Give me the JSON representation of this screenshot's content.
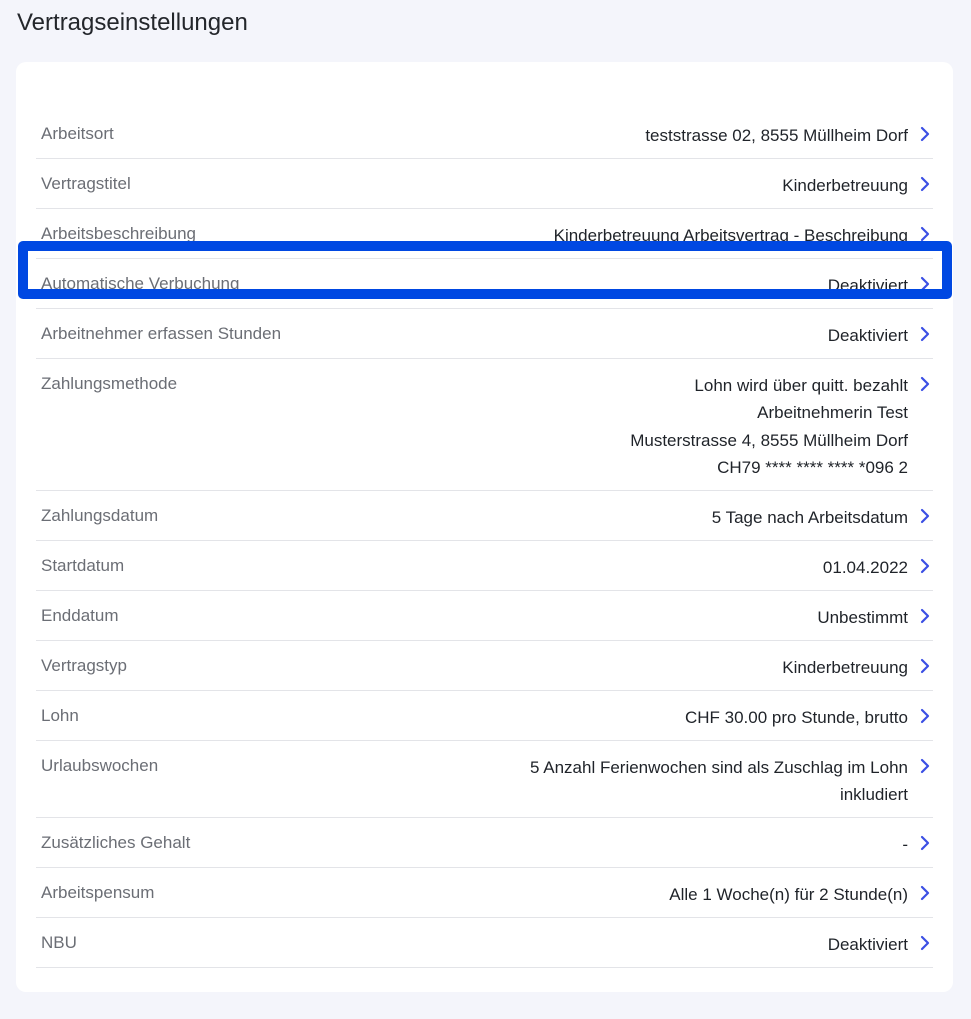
{
  "page": {
    "title": "Vertragseinstellungen"
  },
  "colors": {
    "accent": "#3b4fe4",
    "highlight": "#0048e2",
    "label": "#6b6e75",
    "value": "#1f2329"
  },
  "rows": [
    {
      "key": "arbeitsort",
      "label": "Arbeitsort",
      "values": [
        "teststrasse 02, 8555 Müllheim Dorf"
      ]
    },
    {
      "key": "vertragstitel",
      "label": "Vertragstitel",
      "values": [
        "Kinderbetreuung"
      ]
    },
    {
      "key": "arbeitsbeschreibung",
      "label": "Arbeitsbeschreibung",
      "values": [
        "Kinderbetreuung Arbeitsvertrag - Beschreibung"
      ]
    },
    {
      "key": "automatische-verbuchung",
      "label": "Automatische Verbuchung",
      "values": [
        "Deaktiviert"
      ],
      "highlighted": true
    },
    {
      "key": "arbeitnehmer-erfassen-stunden",
      "label": "Arbeitnehmer erfassen Stunden",
      "values": [
        "Deaktiviert"
      ]
    },
    {
      "key": "zahlungsmethode",
      "label": "Zahlungsmethode",
      "values": [
        "Lohn wird über quitt. bezahlt",
        "Arbeitnehmerin Test",
        "Musterstrasse 4, 8555 Müllheim Dorf",
        "CH79 **** **** **** *096 2"
      ]
    },
    {
      "key": "zahlungsdatum",
      "label": "Zahlungsdatum",
      "values": [
        "5 Tage nach Arbeitsdatum"
      ]
    },
    {
      "key": "startdatum",
      "label": "Startdatum",
      "values": [
        "01.04.2022"
      ]
    },
    {
      "key": "enddatum",
      "label": "Enddatum",
      "values": [
        "Unbestimmt"
      ]
    },
    {
      "key": "vertragstyp",
      "label": "Vertragstyp",
      "values": [
        "Kinderbetreuung"
      ]
    },
    {
      "key": "lohn",
      "label": "Lohn",
      "values": [
        "CHF 30.00 pro Stunde, brutto"
      ]
    },
    {
      "key": "urlaubswochen",
      "label": "Urlaubswochen",
      "values": [
        "5 Anzahl Ferienwochen sind als Zuschlag im Lohn",
        "inkludiert"
      ]
    },
    {
      "key": "zusaetzliches-gehalt",
      "label": "Zusätzliches Gehalt",
      "values": [
        "-"
      ]
    },
    {
      "key": "arbeitspensum",
      "label": "Arbeitspensum",
      "values": [
        "Alle 1 Woche(n) für 2 Stunde(n)"
      ]
    },
    {
      "key": "nbu",
      "label": "NBU",
      "values": [
        "Deaktiviert"
      ]
    }
  ],
  "icons": {
    "row_action": "chevron-right-icon"
  }
}
